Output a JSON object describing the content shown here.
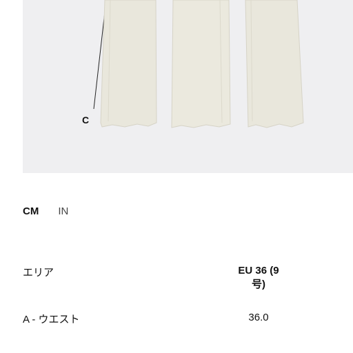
{
  "image": {
    "measure_letter": "C",
    "background_color": "#efeff1",
    "fabric_color": "#e9e7dc"
  },
  "units": {
    "cm_label": "CM",
    "in_label": "IN",
    "selected": "CM"
  },
  "size_table": {
    "header": {
      "label": "エリア",
      "value": "EU 36 (9 号)"
    },
    "rows": [
      {
        "label": "A - ウエスト",
        "value": "36.0"
      }
    ]
  }
}
